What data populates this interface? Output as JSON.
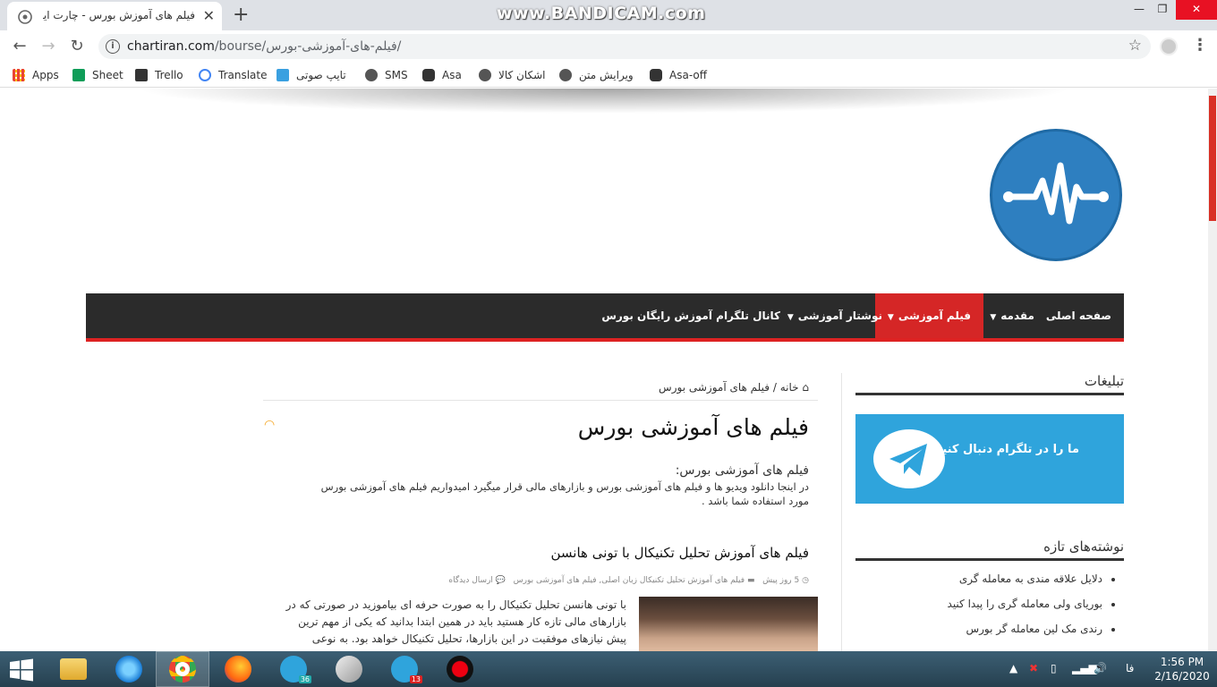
{
  "browser": {
    "tab_title": "فیلم های آموزش بورس - چارت ایرا",
    "url_domain": "chartiran.com",
    "url_path": "/bourse/فیلم-های-آموزشی-بورس/",
    "watermark": "www.BANDICAM.com",
    "bookmarks": [
      {
        "label": "Apps",
        "icon": "apps-grid-icon",
        "color": "#4285f4"
      },
      {
        "label": "Sheet",
        "icon": "sheets-icon",
        "color": "#0f9d58"
      },
      {
        "label": "Trello",
        "icon": "trello-icon",
        "color": "#333333"
      },
      {
        "label": "Translate",
        "icon": "google-icon",
        "color": "#4285f4"
      },
      {
        "label": "تایپ صوتی",
        "icon": "voice-typing-icon",
        "color": "#3aa0e0"
      },
      {
        "label": "SMS",
        "icon": "globe-icon",
        "color": "#555555"
      },
      {
        "label": "Asa",
        "icon": "asa-icon",
        "color": "#333333"
      },
      {
        "label": "اشکان کالا",
        "icon": "globe-icon",
        "color": "#555555"
      },
      {
        "label": "ویرایش متن",
        "icon": "globe-icon",
        "color": "#555555"
      },
      {
        "label": "Asa-off",
        "icon": "asa-icon",
        "color": "#333333"
      }
    ]
  },
  "nav": {
    "items": [
      {
        "label": "صفحه اصلی",
        "dropdown": false,
        "active": false
      },
      {
        "label": "مقدمه",
        "dropdown": true,
        "active": false
      },
      {
        "label": "فیلم آموزشی",
        "dropdown": true,
        "active": true
      },
      {
        "label": "نوشتار آموزشی",
        "dropdown": true,
        "active": false
      },
      {
        "label": "کانال تلگرام آموزش رایگان بورس",
        "dropdown": false,
        "active": false
      }
    ]
  },
  "sidebar": {
    "ads_title": "تبلیغات",
    "ad_text": "ما را در تلگرام دنبال کنید",
    "recent_title": "نوشته‌های تازه",
    "recent": [
      "دلایل علاقه مندی به معامله گری",
      "بوریای ولی معامله گری را پیدا کنید",
      "رندی مک لین معامله گر بورس"
    ]
  },
  "content": {
    "breadcrumb_home": "خانه",
    "breadcrumb_sep": "/",
    "breadcrumb_current": "فیلم های آموزشی بورس",
    "title": "فیلم های آموزشی بورس",
    "desc_heading": "فیلم های آموزشی بورس:",
    "desc_line1": "در اینجا دانلود ویدیو ها و فیلم های آموزشی بورس و بازارهای مالی قرار میگیرد امیدواریم فیلم های آموزشی بورس",
    "desc_line2": "مورد استفاده شما باشد .",
    "post_title": "فیلم های آموزش تحلیل تکنیکال با تونی هانسن",
    "post_time": "5 روز پیش",
    "post_cats": "فیلم های آموزش تحلیل تکنیکال زبان اصلی, فیلم های آموزشی بورس",
    "post_comment": "ارسال دیدگاه",
    "excerpt": [
      "با تونی هانسن تحلیل تکنیکال را به صورت حرفه ای بیاموزید در صورتی که در",
      "بازارهای مالی تازه کار هستید باید در همین ابتدا بدانید که یکی از مهم ترین",
      "پیش نیازهای موفقیت در این بازارها، تحلیل تکنیکال خواهد بود. به نوعی"
    ]
  },
  "taskbar": {
    "apps": [
      {
        "name": "file-explorer",
        "badge": ""
      },
      {
        "name": "internet-explorer",
        "badge": ""
      },
      {
        "name": "chrome",
        "badge": ""
      },
      {
        "name": "firefox",
        "badge": ""
      },
      {
        "name": "telegram",
        "badge": "36"
      },
      {
        "name": "rocket",
        "badge": ""
      },
      {
        "name": "telegram-2",
        "badge": "13"
      },
      {
        "name": "bandicam",
        "badge": ""
      }
    ],
    "lang": "فا",
    "time": "1:56 PM",
    "date": "2/16/2020"
  }
}
